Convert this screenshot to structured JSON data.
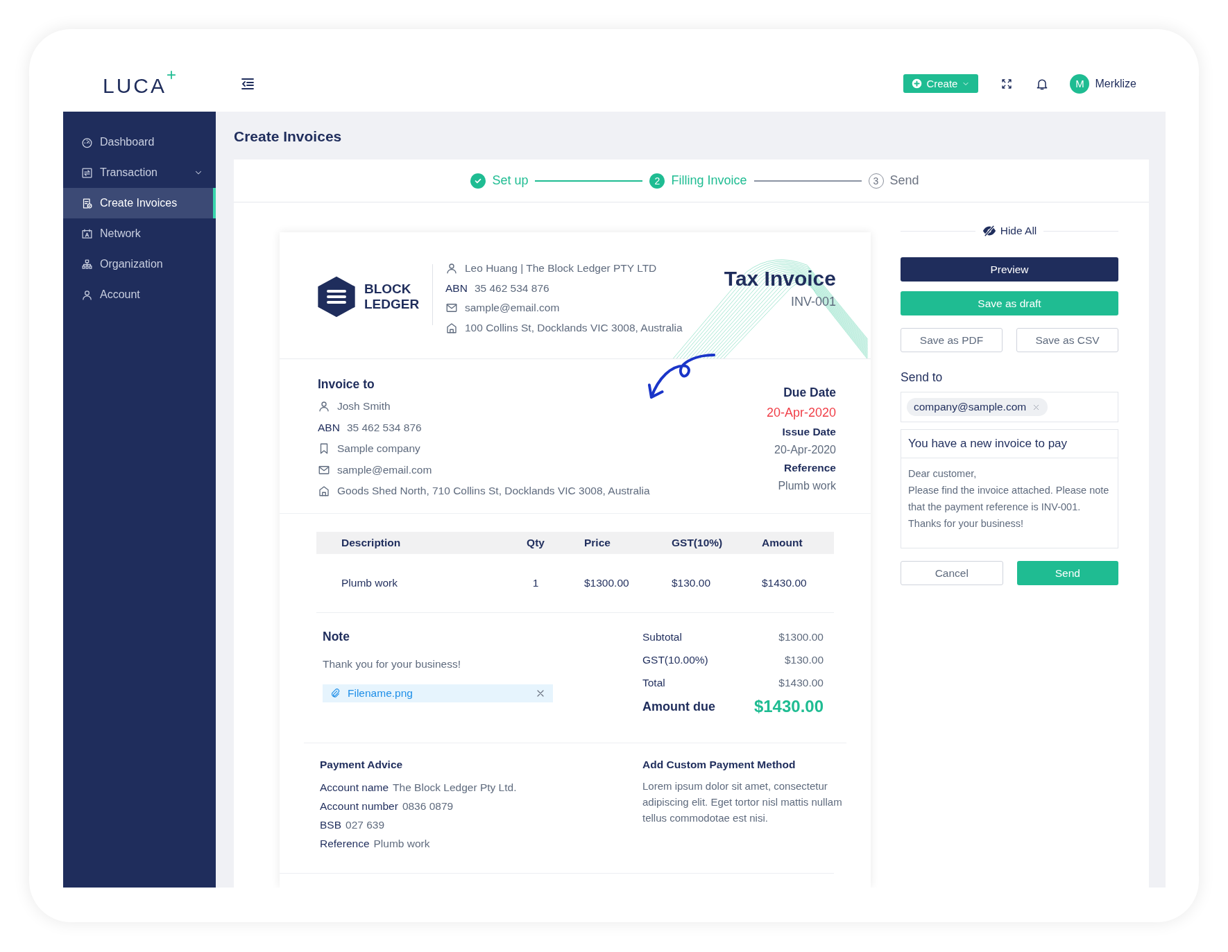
{
  "app": {
    "logo": "LUCA"
  },
  "header": {
    "create_button": "Create",
    "user": {
      "initial": "M",
      "name": "Merklize"
    }
  },
  "sidebar": {
    "items": [
      {
        "label": "Dashboard",
        "selected": false,
        "submenu": false
      },
      {
        "label": "Transaction",
        "selected": false,
        "submenu": true
      },
      {
        "label": "Create Invoices",
        "selected": true,
        "submenu": false
      },
      {
        "label": "Network",
        "selected": false,
        "submenu": false
      },
      {
        "label": "Organization",
        "selected": false,
        "submenu": false
      },
      {
        "label": "Account",
        "selected": false,
        "submenu": false
      }
    ]
  },
  "page_title": "Create Invoices",
  "steps": [
    {
      "label": "Set up",
      "completed": true,
      "active": false
    },
    {
      "number": "2",
      "label": "Filling Invoice",
      "completed": false,
      "active": true
    },
    {
      "number": "3",
      "label": "Send",
      "completed": false,
      "active": false
    }
  ],
  "invoice": {
    "company_logo": [
      "BLOCK",
      "LEDGER"
    ],
    "sender": {
      "name": "Leo Huang | The Block Ledger PTY LTD",
      "abn_label": "ABN",
      "abn": "35 462 534 876",
      "email": "sample@email.com",
      "address": "100 Collins St, Docklands VIC 3008, Australia"
    },
    "title": "Tax Invoice",
    "number": "INV-001",
    "recipient": {
      "heading": "Invoice to",
      "name": "Josh Smith",
      "abn_label": "ABN",
      "abn": "35 462 534 876",
      "company": "Sample company",
      "email": "sample@email.com",
      "address": "Goods Shed North, 710 Collins St, Docklands VIC 3008, Australia"
    },
    "dates": [
      {
        "label": "Due Date",
        "value": "20-Apr-2020",
        "overdue": true
      },
      {
        "label": "Issue Date",
        "value": "20-Apr-2020",
        "overdue": false
      },
      {
        "label": "Reference",
        "value": "Plumb work",
        "overdue": false
      }
    ],
    "table": {
      "columns": [
        "Description",
        "Qty",
        "Price",
        "GST(10%)",
        "Amount"
      ],
      "rows": [
        [
          "Plumb work",
          "1",
          "$1300.00",
          "$130.00",
          "$1430.00"
        ]
      ]
    },
    "note": {
      "heading": "Note",
      "text": "Thank you for your business!",
      "attachment": "Filename.png"
    },
    "totals": [
      {
        "label": "Subtotal",
        "value": "$1300.00"
      },
      {
        "label": "GST(10.00%)",
        "value": "$130.00"
      },
      {
        "label": "Total",
        "value": "$1430.00"
      }
    ],
    "amount_due": {
      "label": "Amount due",
      "value": "$1430.00"
    },
    "payment_advice": {
      "heading": "Payment Advice",
      "fields": [
        {
          "label": "Account name",
          "value": "The Block Ledger Pty Ltd."
        },
        {
          "label": "Account number",
          "value": "0836 0879"
        },
        {
          "label": "BSB",
          "value": "027 639"
        },
        {
          "label": "Reference",
          "value": "Plumb work"
        }
      ]
    },
    "custom_payment": {
      "heading": "Add Custom Payment Method",
      "text": "Lorem ipsum dolor sit amet, consectetur adipiscing elit. Eget tortor nisl mattis nullam tellus commodotae est nisi."
    }
  },
  "panel": {
    "hide_all": "Hide All",
    "buttons": [
      {
        "label": "Preview",
        "kind": "dark"
      },
      {
        "label": "Save as draft",
        "kind": "primary"
      }
    ],
    "export_buttons": [
      {
        "label": "Save as PDF",
        "kind": "outline"
      },
      {
        "label": "Save as CSV",
        "kind": "outline"
      }
    ],
    "send_to": {
      "label": "Send to",
      "recipients": [
        "company@sample.com"
      ]
    },
    "message": {
      "subject": "You have a new invoice to pay",
      "body": [
        "Dear customer,",
        "Please find the invoice attached. Please note that the payment reference is INV-001.",
        "Thanks for your business!"
      ]
    },
    "actions": [
      {
        "label": "Cancel",
        "kind": "outline"
      },
      {
        "label": "Send",
        "kind": "primary"
      }
    ]
  }
}
